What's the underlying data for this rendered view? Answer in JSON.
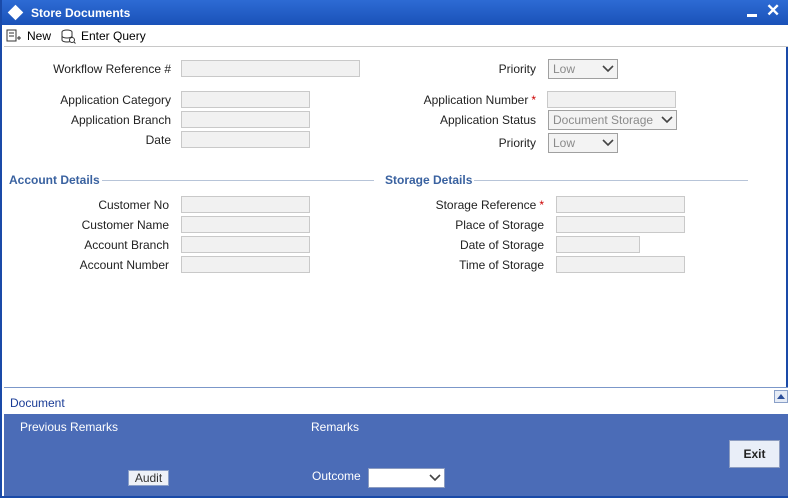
{
  "window": {
    "title": "Store Documents"
  },
  "toolbar": {
    "new_label": "New",
    "enter_query_label": "Enter Query"
  },
  "header": {
    "workflow_reference": {
      "label": "Workflow Reference #",
      "value": ""
    },
    "priority_top": {
      "label": "Priority",
      "value": "Low"
    },
    "application_category": {
      "label": "Application Category",
      "value": ""
    },
    "application_branch": {
      "label": "Application Branch",
      "value": ""
    },
    "date": {
      "label": "Date",
      "value": ""
    },
    "application_number": {
      "label": "Application Number",
      "value": ""
    },
    "application_status": {
      "label": "Application Status",
      "value": "Document Storage"
    },
    "priority": {
      "label": "Priority",
      "value": "Low"
    },
    "required_marker": "*"
  },
  "account_details": {
    "title": "Account Details",
    "customer_no": {
      "label": "Customer No",
      "value": ""
    },
    "customer_name": {
      "label": "Customer Name",
      "value": ""
    },
    "account_branch": {
      "label": "Account Branch",
      "value": ""
    },
    "account_number": {
      "label": "Account Number",
      "value": ""
    }
  },
  "storage_details": {
    "title": "Storage Details",
    "storage_reference": {
      "label": "Storage Reference",
      "value": ""
    },
    "place_of_storage": {
      "label": "Place of Storage",
      "value": ""
    },
    "date_of_storage": {
      "label": "Date of Storage",
      "value": ""
    },
    "time_of_storage": {
      "label": "Time of Storage",
      "value": ""
    }
  },
  "document_bar": {
    "label": "Document"
  },
  "footer": {
    "previous_remarks_label": "Previous Remarks",
    "remarks_label": "Remarks",
    "audit_label": "Audit",
    "outcome_label": "Outcome",
    "outcome_value": "",
    "exit_label": "Exit"
  },
  "colors": {
    "titlebar": "#1a52b8",
    "footer": "#4b6cb7",
    "section_title": "#3a62a0",
    "required": "#cc0000"
  }
}
